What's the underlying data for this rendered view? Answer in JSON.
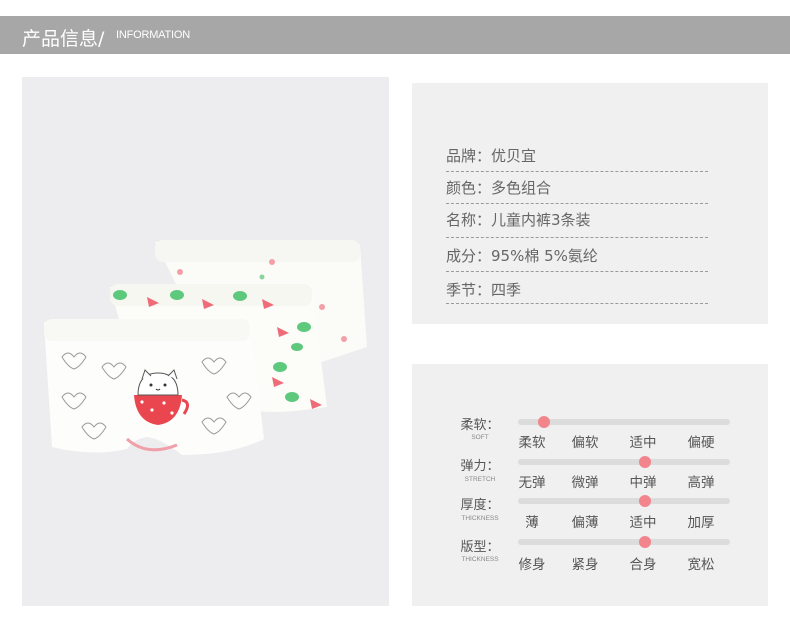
{
  "header": {
    "title": "产品信息/",
    "subtitle": "INFORMATION"
  },
  "photo": {
    "icon": "product-image",
    "colors": {
      "accent": "#f2848c",
      "green": "#5ec97d"
    }
  },
  "info": {
    "rows": [
      {
        "label": "品牌：优贝宜"
      },
      {
        "label": "颜色：多色组合"
      },
      {
        "label": "名称：儿童内裤3条装"
      },
      {
        "label": "成分：95%棉 5%氨纶"
      },
      {
        "label": "季节：四季"
      }
    ]
  },
  "properties": [
    {
      "label": "柔软：",
      "en": "SOFT",
      "options": [
        "柔软",
        "偏软",
        "适中",
        "偏硬"
      ],
      "level": 0
    },
    {
      "label": "弹力：",
      "en": "STRETCH",
      "options": [
        "无弹",
        "微弹",
        "中弹",
        "高弹"
      ],
      "level": 2
    },
    {
      "label": "厚度：",
      "en": "THICKNESS",
      "options": [
        "薄",
        "偏薄",
        "适中",
        "加厚"
      ],
      "level": 2
    },
    {
      "label": "版型：",
      "en": "THICKNESS",
      "options": [
        "修身",
        "紧身",
        "合身",
        "宽松"
      ],
      "level": 2
    }
  ],
  "colors": {
    "header_bg": "#a7a7a7",
    "panel_bg": "#f0f0f0",
    "slider_dot": "#f2848c"
  }
}
